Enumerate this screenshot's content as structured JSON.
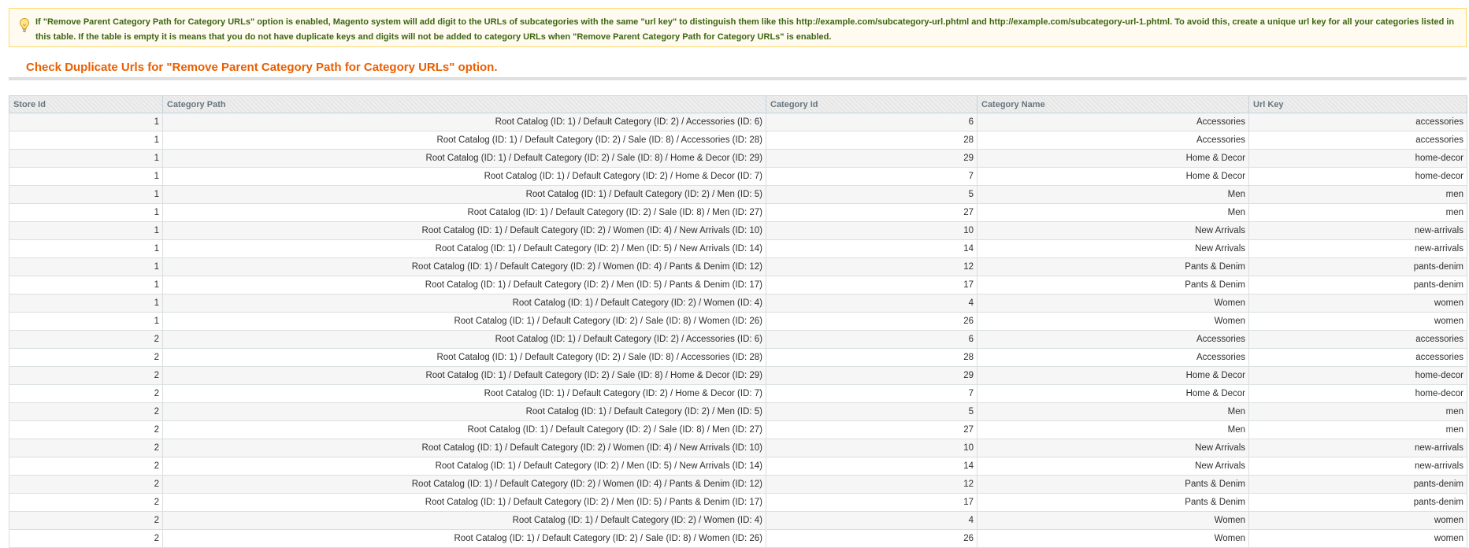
{
  "notice": {
    "icon": "lightbulb-icon",
    "text": "If \"Remove Parent Category Path for Category URLs\" option is enabled, Magento system will add digit to the URLs of subcategories with the same \"url key\" to distinguish them like this http://example.com/subcategory-url.phtml and http://example.com/subcategory-url-1.phtml. To avoid this, create a unique url key for all your categories listed in this table. If the table is empty it is means that you do not have duplicate keys and digits will not be added to category URLs when \"Remove Parent Category Path for Category URLs\" is enabled."
  },
  "section": {
    "title": "Check Duplicate Urls for \"Remove Parent Category Path for Category URLs\" option."
  },
  "table": {
    "columns": [
      "Store Id",
      "Category Path",
      "Category Id",
      "Category Name",
      "Url Key"
    ],
    "rows": [
      [
        "1",
        "Root Catalog (ID: 1) / Default Category (ID: 2) / Accessories (ID: 6)",
        "6",
        "Accessories",
        "accessories"
      ],
      [
        "1",
        "Root Catalog (ID: 1) / Default Category (ID: 2) / Sale (ID: 8) / Accessories (ID: 28)",
        "28",
        "Accessories",
        "accessories"
      ],
      [
        "1",
        "Root Catalog (ID: 1) / Default Category (ID: 2) / Sale (ID: 8) / Home & Decor (ID: 29)",
        "29",
        "Home & Decor",
        "home-decor"
      ],
      [
        "1",
        "Root Catalog (ID: 1) / Default Category (ID: 2) / Home & Decor (ID: 7)",
        "7",
        "Home & Decor",
        "home-decor"
      ],
      [
        "1",
        "Root Catalog (ID: 1) / Default Category (ID: 2) / Men (ID: 5)",
        "5",
        "Men",
        "men"
      ],
      [
        "1",
        "Root Catalog (ID: 1) / Default Category (ID: 2) / Sale (ID: 8) / Men (ID: 27)",
        "27",
        "Men",
        "men"
      ],
      [
        "1",
        "Root Catalog (ID: 1) / Default Category (ID: 2) / Women (ID: 4) / New Arrivals (ID: 10)",
        "10",
        "New Arrivals",
        "new-arrivals"
      ],
      [
        "1",
        "Root Catalog (ID: 1) / Default Category (ID: 2) / Men (ID: 5) / New Arrivals (ID: 14)",
        "14",
        "New Arrivals",
        "new-arrivals"
      ],
      [
        "1",
        "Root Catalog (ID: 1) / Default Category (ID: 2) / Women (ID: 4) / Pants & Denim (ID: 12)",
        "12",
        "Pants & Denim",
        "pants-denim"
      ],
      [
        "1",
        "Root Catalog (ID: 1) / Default Category (ID: 2) / Men (ID: 5) / Pants & Denim (ID: 17)",
        "17",
        "Pants & Denim",
        "pants-denim"
      ],
      [
        "1",
        "Root Catalog (ID: 1) / Default Category (ID: 2) / Women (ID: 4)",
        "4",
        "Women",
        "women"
      ],
      [
        "1",
        "Root Catalog (ID: 1) / Default Category (ID: 2) / Sale (ID: 8) / Women (ID: 26)",
        "26",
        "Women",
        "women"
      ],
      [
        "2",
        "Root Catalog (ID: 1) / Default Category (ID: 2) / Accessories (ID: 6)",
        "6",
        "Accessories",
        "accessories"
      ],
      [
        "2",
        "Root Catalog (ID: 1) / Default Category (ID: 2) / Sale (ID: 8) / Accessories (ID: 28)",
        "28",
        "Accessories",
        "accessories"
      ],
      [
        "2",
        "Root Catalog (ID: 1) / Default Category (ID: 2) / Sale (ID: 8) / Home & Decor (ID: 29)",
        "29",
        "Home & Decor",
        "home-decor"
      ],
      [
        "2",
        "Root Catalog (ID: 1) / Default Category (ID: 2) / Home & Decor (ID: 7)",
        "7",
        "Home & Decor",
        "home-decor"
      ],
      [
        "2",
        "Root Catalog (ID: 1) / Default Category (ID: 2) / Men (ID: 5)",
        "5",
        "Men",
        "men"
      ],
      [
        "2",
        "Root Catalog (ID: 1) / Default Category (ID: 2) / Sale (ID: 8) / Men (ID: 27)",
        "27",
        "Men",
        "men"
      ],
      [
        "2",
        "Root Catalog (ID: 1) / Default Category (ID: 2) / Women (ID: 4) / New Arrivals (ID: 10)",
        "10",
        "New Arrivals",
        "new-arrivals"
      ],
      [
        "2",
        "Root Catalog (ID: 1) / Default Category (ID: 2) / Men (ID: 5) / New Arrivals (ID: 14)",
        "14",
        "New Arrivals",
        "new-arrivals"
      ],
      [
        "2",
        "Root Catalog (ID: 1) / Default Category (ID: 2) / Women (ID: 4) / Pants & Denim (ID: 12)",
        "12",
        "Pants & Denim",
        "pants-denim"
      ],
      [
        "2",
        "Root Catalog (ID: 1) / Default Category (ID: 2) / Men (ID: 5) / Pants & Denim (ID: 17)",
        "17",
        "Pants & Denim",
        "pants-denim"
      ],
      [
        "2",
        "Root Catalog (ID: 1) / Default Category (ID: 2) / Women (ID: 4)",
        "4",
        "Women",
        "women"
      ],
      [
        "2",
        "Root Catalog (ID: 1) / Default Category (ID: 2) / Sale (ID: 8) / Women (ID: 26)",
        "26",
        "Women",
        "women"
      ]
    ]
  }
}
